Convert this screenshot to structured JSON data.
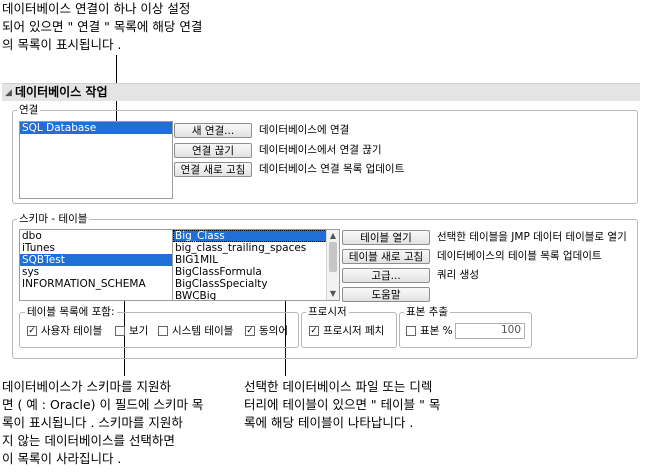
{
  "callouts": {
    "top": "데이터베이스 연결이 하나 이상 설정\n되어 있으면 \" 연결 \" 목록에 해당 연결\n의 목록이 표시됩니다 .",
    "bottom_left": "데이터베이스가 스키마를 지원하\n면 ( 예 : Oracle) 이 필드에 스키마 목\n록이 표시됩니다 . 스키마를 지원하\n지 않는 데이터베이스를 선택하면\n이 목록이 사라집니다 .",
    "bottom_right": "선택한 데이터베이스 파일 또는 디렉\n터리에 테이블이 있으면 \" 테이블 \" 목\n록에 해당 테이블이 나타납니다 ."
  },
  "section": {
    "title": "데이터베이스 작업"
  },
  "connections": {
    "legend": "연결",
    "items": [
      "SQL Database"
    ],
    "selected_index": 0,
    "buttons": [
      {
        "label": "새 연결...",
        "desc": "데이터베이스에 연결"
      },
      {
        "label": "연결 끊기",
        "desc": "데이터베이스에서 연결 끊기"
      },
      {
        "label": "연결 새로 고침",
        "desc": "데이터베이스 연결 목록 업데이트"
      }
    ]
  },
  "schema_tables": {
    "legend": "스키마 - 테이블",
    "schemas": [
      "dbo",
      "iTunes",
      "SQBTest",
      "sys",
      "INFORMATION_SCHEMA"
    ],
    "schema_selected_index": 2,
    "tables": [
      "Big_Class",
      "big_class_trailing_spaces",
      "BIG1MIL",
      "BigClassFormula",
      "BigClassSpecialty",
      "BWCBig"
    ],
    "table_selected_index": 0,
    "buttons": [
      {
        "label": "테이블 열기",
        "desc": "선택한 테이블을 JMP 데이터 테이블로 열기"
      },
      {
        "label": "테이블 새로 고침",
        "desc": "데이터베이스의 테이블 목록 업데이트"
      },
      {
        "label": "고급...",
        "desc": "쿼리 생성"
      },
      {
        "label": "도움말",
        "desc": ""
      }
    ],
    "include": {
      "legend": "테이블 목록에 포함:",
      "options": [
        {
          "label": "사용자 테이블",
          "checked": true
        },
        {
          "label": "보기",
          "checked": false
        },
        {
          "label": "시스템 테이블",
          "checked": false
        },
        {
          "label": "동의어",
          "checked": true
        }
      ]
    },
    "procedures": {
      "legend": "프로시저",
      "option": {
        "label": "프로시저 페치",
        "checked": true
      }
    },
    "sample": {
      "legend": "표본 추출",
      "option": {
        "label": "표본 %",
        "checked": false
      },
      "value": "100"
    }
  }
}
